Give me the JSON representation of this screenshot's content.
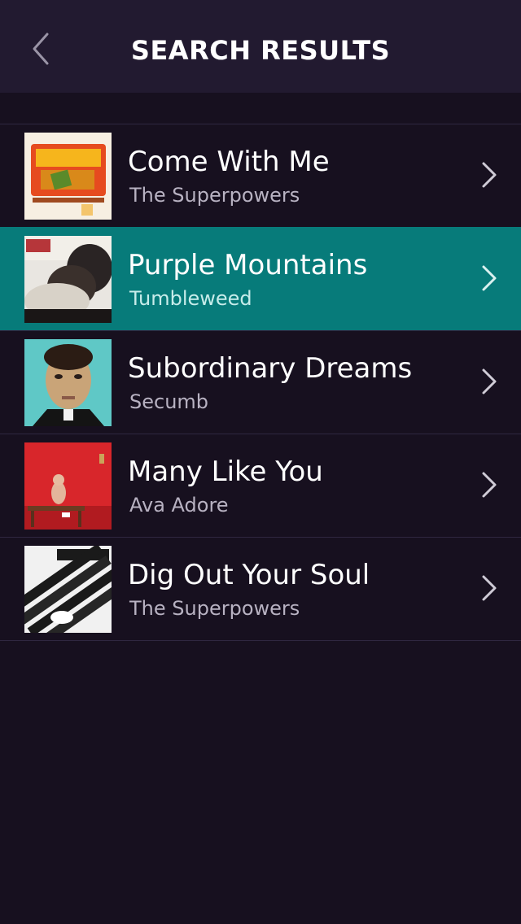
{
  "header": {
    "title": "SEARCH RESULTS",
    "back_icon": "chevron-left-icon"
  },
  "results": [
    {
      "title": "Come With Me",
      "artist": "The Superpowers",
      "selected": false
    },
    {
      "title": "Purple Mountains",
      "artist": "Tumbleweed",
      "selected": true
    },
    {
      "title": "Subordinary Dreams",
      "artist": "Secumb",
      "selected": false
    },
    {
      "title": "Many Like You",
      "artist": "Ava Adore",
      "selected": false
    },
    {
      "title": "Dig Out Your Soul",
      "artist": "The Superpowers",
      "selected": false
    }
  ],
  "colors": {
    "background": "#17101f",
    "header": "#221a30",
    "selected_row": "#077b7a",
    "divider": "#2f2740"
  }
}
